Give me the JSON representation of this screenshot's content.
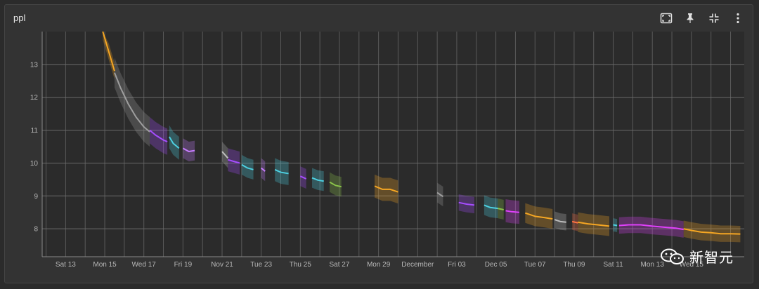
{
  "panel": {
    "title": "ppl"
  },
  "toolbar": {
    "icons": [
      "fullscreen-icon",
      "pin-icon",
      "collapse-icon",
      "more-vert-icon"
    ]
  },
  "watermark": {
    "text": "新智元",
    "icon": "wechat-icon"
  },
  "chart_data": {
    "type": "line",
    "title": "ppl",
    "xlabel": "",
    "ylabel": "",
    "xlim": [
      -0.2,
      35.7
    ],
    "ylim": [
      7.15,
      14.0
    ],
    "grid": true,
    "y_ticks": [
      8,
      9,
      10,
      11,
      12,
      13
    ],
    "x_ticks": [
      {
        "x": 1,
        "label": "Sat 13",
        "dim": true
      },
      {
        "x": 3,
        "label": "Mon 15"
      },
      {
        "x": 5,
        "label": "Wed 17"
      },
      {
        "x": 7,
        "label": "Fri 19"
      },
      {
        "x": 9,
        "label": "Nov 21"
      },
      {
        "x": 11,
        "label": "Tue 23"
      },
      {
        "x": 13,
        "label": "Thu 25"
      },
      {
        "x": 15,
        "label": "Sat 27"
      },
      {
        "x": 17,
        "label": "Mon 29"
      },
      {
        "x": 19,
        "label": "December"
      },
      {
        "x": 21,
        "label": "Fri 03"
      },
      {
        "x": 23,
        "label": "Dec 05"
      },
      {
        "x": 25,
        "label": "Tue 07"
      },
      {
        "x": 27,
        "label": "Thu 09"
      },
      {
        "x": 29,
        "label": "Sat 11"
      },
      {
        "x": 31,
        "label": "Mon 13"
      },
      {
        "x": 33,
        "label": "Wed 15"
      }
    ],
    "series": [
      {
        "color": "#f5a623",
        "band": 0.25,
        "x": [
          2.9,
          3.2,
          3.5
        ],
        "y": [
          14.0,
          13.4,
          12.8
        ]
      },
      {
        "color": "#9e9e9e",
        "band": 0.45,
        "x": [
          3.5,
          3.8,
          4.2,
          4.6,
          5.0,
          5.3
        ],
        "y": [
          12.75,
          12.3,
          11.8,
          11.4,
          11.1,
          10.95
        ]
      },
      {
        "color": "#a64dff",
        "band": 0.4,
        "x": [
          5.3,
          5.6,
          6.0,
          6.2
        ],
        "y": [
          11.0,
          10.85,
          10.7,
          10.65
        ]
      },
      {
        "color": "#4dd0e1",
        "band": 0.35,
        "x": [
          6.3,
          6.5,
          6.8
        ],
        "y": [
          10.8,
          10.6,
          10.45
        ]
      },
      {
        "color": "#c77dff",
        "band": 0.3,
        "x": [
          7.0,
          7.3,
          7.6
        ],
        "y": [
          10.45,
          10.35,
          10.38
        ]
      },
      {
        "color": "#bdbdbd",
        "band": 0.3,
        "x": [
          9.0,
          9.3
        ],
        "y": [
          10.35,
          10.15
        ]
      },
      {
        "color": "#a64dff",
        "band": 0.35,
        "x": [
          9.3,
          9.6,
          9.9
        ],
        "y": [
          10.1,
          10.05,
          10.0
        ]
      },
      {
        "color": "#4dd0e1",
        "band": 0.3,
        "x": [
          10.0,
          10.3,
          10.6
        ],
        "y": [
          9.95,
          9.85,
          9.8
        ]
      },
      {
        "color": "#c77dff",
        "band": 0.3,
        "x": [
          11.0,
          11.2
        ],
        "y": [
          9.85,
          9.75
        ]
      },
      {
        "color": "#4dd0e1",
        "band": 0.35,
        "x": [
          11.7,
          12.0,
          12.4
        ],
        "y": [
          9.8,
          9.72,
          9.68
        ]
      },
      {
        "color": "#a64dff",
        "band": 0.3,
        "x": [
          13.0,
          13.3
        ],
        "y": [
          9.6,
          9.52
        ]
      },
      {
        "color": "#4dd0e1",
        "band": 0.3,
        "x": [
          13.6,
          13.9,
          14.2
        ],
        "y": [
          9.55,
          9.48,
          9.45
        ]
      },
      {
        "color": "#8bc34a",
        "band": 0.3,
        "x": [
          14.5,
          14.8,
          15.1
        ],
        "y": [
          9.42,
          9.32,
          9.28
        ]
      },
      {
        "color": "#f5a623",
        "band": 0.35,
        "x": [
          16.8,
          17.2,
          17.6,
          18.0
        ],
        "y": [
          9.3,
          9.2,
          9.2,
          9.12
        ]
      },
      {
        "color": "#9e9e9e",
        "band": 0.3,
        "x": [
          20.0,
          20.3
        ],
        "y": [
          9.1,
          8.98
        ]
      },
      {
        "color": "#a64dff",
        "band": 0.25,
        "x": [
          21.1,
          21.5,
          21.9
        ],
        "y": [
          8.8,
          8.75,
          8.72
        ]
      },
      {
        "color": "#4dd0e1",
        "band": 0.3,
        "x": [
          22.4,
          22.7,
          23.1
        ],
        "y": [
          8.72,
          8.65,
          8.62
        ]
      },
      {
        "color": "#8bc34a",
        "band": 0.3,
        "x": [
          23.1,
          23.4
        ],
        "y": [
          8.62,
          8.58
        ]
      },
      {
        "color": "#e040fb",
        "band": 0.35,
        "x": [
          23.5,
          23.8,
          24.2
        ],
        "y": [
          8.55,
          8.52,
          8.5
        ]
      },
      {
        "color": "#f5a623",
        "band": 0.3,
        "x": [
          24.5,
          25.0,
          25.5,
          25.9
        ],
        "y": [
          8.48,
          8.38,
          8.34,
          8.3
        ]
      },
      {
        "color": "#bdbdbd",
        "band": 0.25,
        "x": [
          26.0,
          26.3,
          26.6
        ],
        "y": [
          8.28,
          8.22,
          8.2
        ]
      },
      {
        "color": "#ff7043",
        "band": 0.25,
        "x": [
          26.9,
          27.2
        ],
        "y": [
          8.22,
          8.18
        ]
      },
      {
        "color": "#f5a623",
        "band": 0.3,
        "x": [
          27.2,
          27.7,
          28.2,
          28.8
        ],
        "y": [
          8.2,
          8.15,
          8.12,
          8.08
        ]
      },
      {
        "color": "#4dd0e1",
        "band": 0.2,
        "x": [
          29.0,
          29.2
        ],
        "y": [
          8.12,
          8.1
        ]
      },
      {
        "color": "#e040fb",
        "band": 0.25,
        "x": [
          29.3,
          29.8,
          30.4,
          31.0,
          31.6,
          32.2,
          32.6
        ],
        "y": [
          8.1,
          8.12,
          8.12,
          8.08,
          8.05,
          8.02,
          7.98
        ]
      },
      {
        "color": "#f5a623",
        "band": 0.25,
        "x": [
          32.6,
          33.0,
          33.5,
          34.0,
          34.5,
          35.0,
          35.5
        ],
        "y": [
          8.0,
          7.95,
          7.9,
          7.88,
          7.85,
          7.85,
          7.84
        ]
      }
    ]
  }
}
